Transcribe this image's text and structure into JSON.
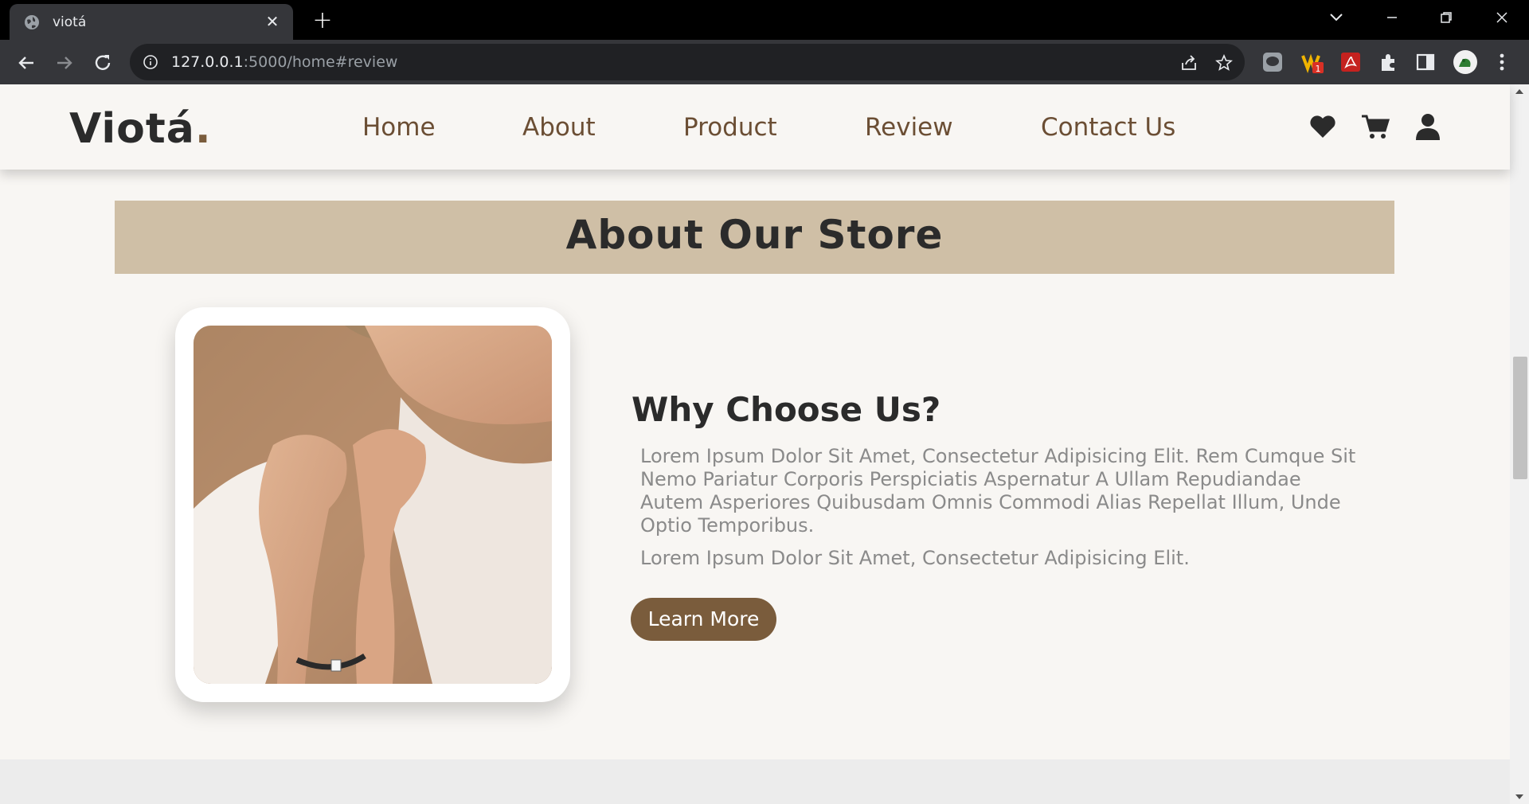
{
  "browser": {
    "tab_title": "viotá",
    "url_host": "127.0.0.1",
    "url_rest": ":5000/home#review",
    "new_tab_symbol": "+",
    "close_symbol": "✕"
  },
  "site": {
    "logo_text": "Viotá",
    "logo_dot": ".",
    "nav": [
      "Home",
      "About",
      "Product",
      "Review",
      "Contact Us"
    ],
    "header_icons": [
      "heart-icon",
      "cart-icon",
      "user-icon"
    ]
  },
  "about": {
    "section_title": "About Our Store",
    "heading": "Why Choose Us?",
    "paragraph_1": "Lorem Ipsum Dolor Sit Amet, Consectetur Adipisicing Elit. Rem Cumque Sit Nemo Pariatur Corporis Perspiciatis Aspernatur A Ullam Repudiandae Autem Asperiores Quibusdam Omnis Commodi Alias Repellat Illum, Unde Optio Temporibus.",
    "paragraph_2": "Lorem Ipsum Dolor Sit Amet, Consectetur Adipisicing Elit.",
    "button_label": "Learn More"
  },
  "colors": {
    "accent": "#7a5c3c",
    "title_band": "#cfbfa6",
    "page_bg": "#f8f6f3"
  }
}
